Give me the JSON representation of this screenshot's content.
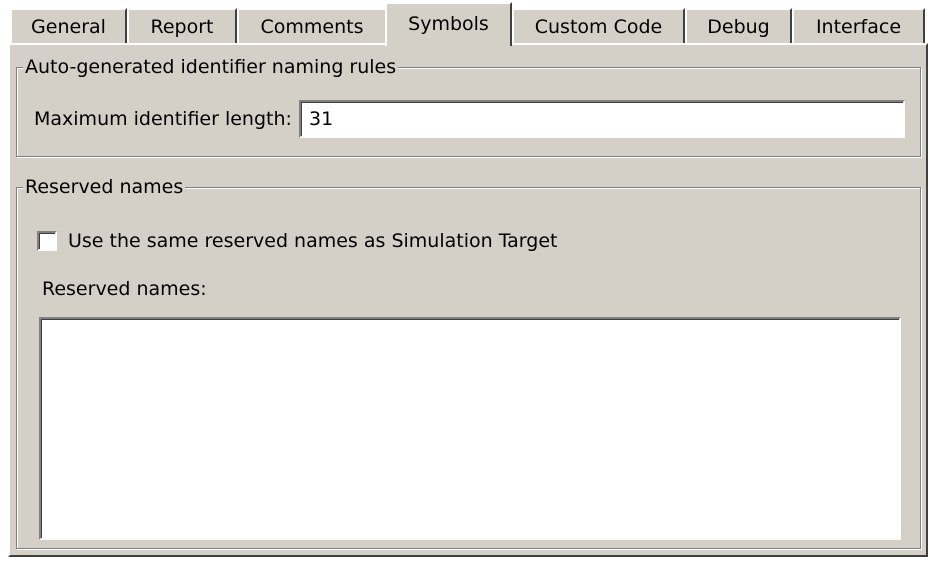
{
  "tabs": [
    {
      "label": "General",
      "active": false
    },
    {
      "label": "Report",
      "active": false
    },
    {
      "label": "Comments",
      "active": false
    },
    {
      "label": "Symbols",
      "active": true
    },
    {
      "label": "Custom Code",
      "active": false
    },
    {
      "label": "Debug",
      "active": false
    },
    {
      "label": "Interface",
      "active": false
    }
  ],
  "naming_rules": {
    "group_title": "Auto-generated identifier naming rules",
    "max_length_label": "Maximum identifier length:",
    "max_length_value": "31"
  },
  "reserved": {
    "group_title": "Reserved names",
    "same_as_sim_label": "Use the same reserved names as Simulation Target",
    "same_as_sim_checked": false,
    "list_label": "Reserved names:",
    "list_value": ""
  },
  "colors": {
    "face": "#d4d0c8",
    "highlight": "#ffffff",
    "shadow": "#808080",
    "dark_shadow": "#404040"
  }
}
